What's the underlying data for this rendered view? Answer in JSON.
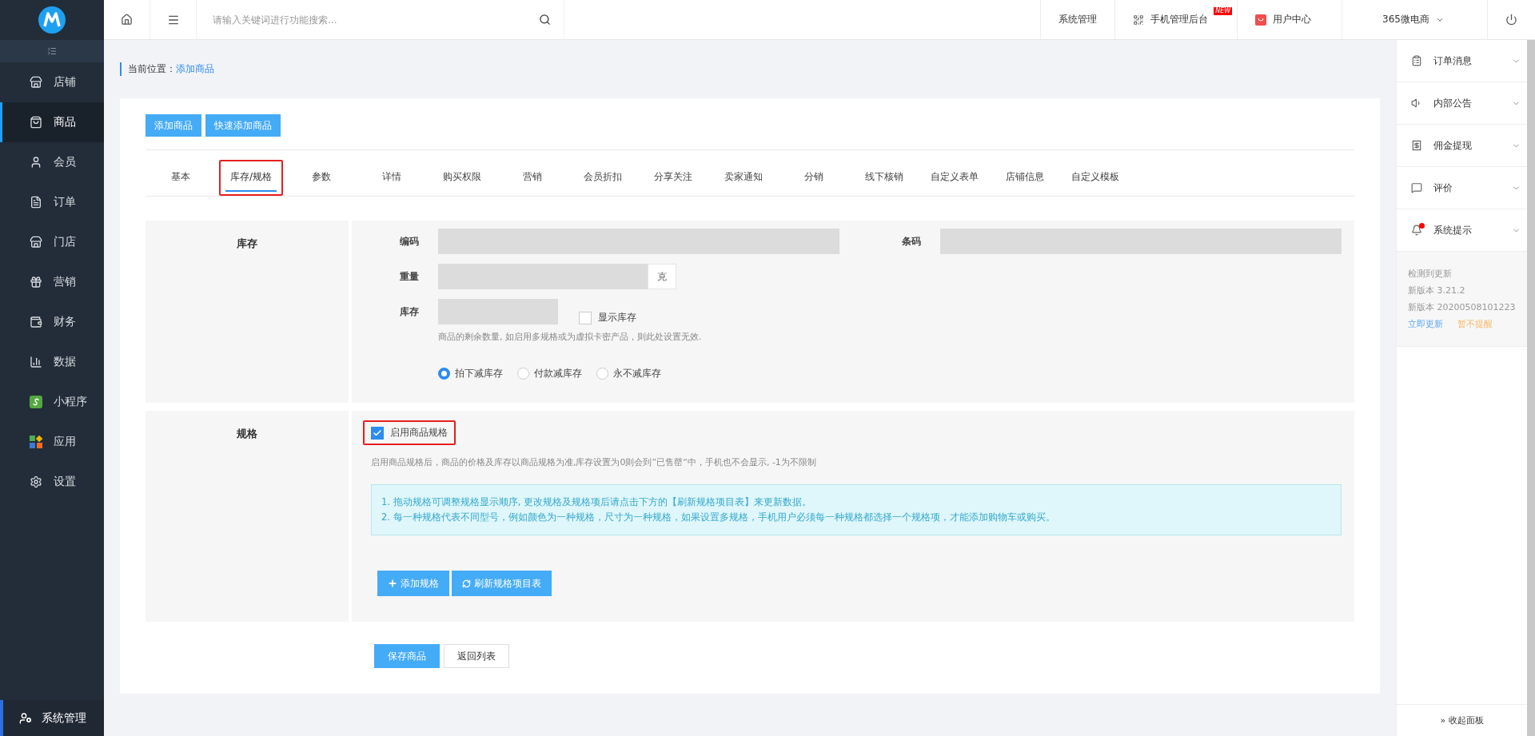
{
  "sidebar": {
    "items": [
      {
        "label": "店铺",
        "selected": false
      },
      {
        "label": "商品",
        "selected": true
      },
      {
        "label": "会员",
        "selected": false
      },
      {
        "label": "订单",
        "selected": false
      },
      {
        "label": "门店",
        "selected": false
      },
      {
        "label": "营销",
        "selected": false
      },
      {
        "label": "财务",
        "selected": false
      },
      {
        "label": "数据",
        "selected": false
      },
      {
        "label": "小程序",
        "selected": false
      },
      {
        "label": "应用",
        "selected": false
      },
      {
        "label": "设置",
        "selected": false
      }
    ],
    "footer": "系统管理"
  },
  "topbar": {
    "search": {
      "placeholder": "请输入关键词进行功能搜索..."
    },
    "links": [
      {
        "kind": "text",
        "label": "系统管理"
      },
      {
        "kind": "mobile",
        "label": "手机管理后台",
        "badge": "NEW"
      },
      {
        "kind": "user",
        "label": "用户中心"
      },
      {
        "kind": "menu",
        "label": "365微电商"
      }
    ]
  },
  "breadcrumb": {
    "prefix": "当前位置：",
    "current": "添加商品"
  },
  "actions": [
    "添加商品",
    "快速添加商品"
  ],
  "tabs": [
    {
      "label": "基本",
      "selected": false,
      "highlighted": false
    },
    {
      "label": "库存/规格",
      "selected": true,
      "highlighted": true
    },
    {
      "label": "参数",
      "selected": false,
      "highlighted": false
    },
    {
      "label": "详情",
      "selected": false,
      "highlighted": false
    },
    {
      "label": "购买权限",
      "selected": false,
      "highlighted": false
    },
    {
      "label": "营销",
      "selected": false,
      "highlighted": false
    },
    {
      "label": "会员折扣",
      "selected": false,
      "highlighted": false
    },
    {
      "label": "分享关注",
      "selected": false,
      "highlighted": false
    },
    {
      "label": "卖家通知",
      "selected": false,
      "highlighted": false
    },
    {
      "label": "分销",
      "selected": false,
      "highlighted": false
    },
    {
      "label": "线下核销",
      "selected": false,
      "highlighted": false
    },
    {
      "label": "自定义表单",
      "selected": false,
      "highlighted": false
    },
    {
      "label": "店铺信息",
      "selected": false,
      "highlighted": false
    },
    {
      "label": "自定义模板",
      "selected": false,
      "highlighted": false
    }
  ],
  "stock": {
    "title": "库存",
    "code_label": "编码",
    "barcode_label": "条码",
    "weight_label": "重量",
    "weight_unit": "克",
    "stock_label": "库存",
    "show_stock": {
      "label": "显示库存",
      "checked": false
    },
    "hint": "商品的剩余数量, 如启用多规格或为虚拟卡密产品，则此处设置无效.",
    "deduct": [
      {
        "label": "拍下减库存",
        "selected": true
      },
      {
        "label": "付款减库存",
        "selected": false
      },
      {
        "label": "永不减库存",
        "selected": false
      }
    ]
  },
  "spec": {
    "title": "规格",
    "enable": {
      "label": "启用商品规格",
      "checked": true,
      "highlighted": true
    },
    "hint": "启用商品规格后，商品的价格及库存以商品规格为准,库存设置为0则会到”已售罄“中，手机也不会显示, -1为不限制",
    "notes": [
      "1. 拖动规格可调整规格显示顺序, 更改规格及规格项后请点击下方的【刷新规格项目表】来更新数据。",
      "2. 每一种规格代表不同型号，例如颜色为一种规格，尺寸为一种规格，如果设置多规格，手机用户必须每一种规格都选择一个规格项，才能添加购物车或购买。"
    ],
    "buttons": [
      {
        "kind": "add",
        "label": "添加规格"
      },
      {
        "kind": "refresh",
        "label": "刷新规格项目表"
      }
    ]
  },
  "footer_buttons": [
    {
      "kind": "primary",
      "label": "保存商品"
    },
    {
      "kind": "default",
      "label": "返回列表"
    }
  ],
  "right_panel": {
    "items": [
      {
        "label": "订单消息",
        "alert": false
      },
      {
        "label": "内部公告",
        "alert": false
      },
      {
        "label": "佣金提现",
        "alert": false
      },
      {
        "label": "评价",
        "alert": false
      },
      {
        "label": "系统提示",
        "alert": true
      }
    ],
    "update": {
      "title": "检测到更新",
      "lines": [
        "新版本 3.21.2",
        "新版本 20200508101223"
      ],
      "update_link": "立即更新",
      "dismiss_link": "暂不提醒"
    },
    "collapse": "» 收起面板"
  }
}
